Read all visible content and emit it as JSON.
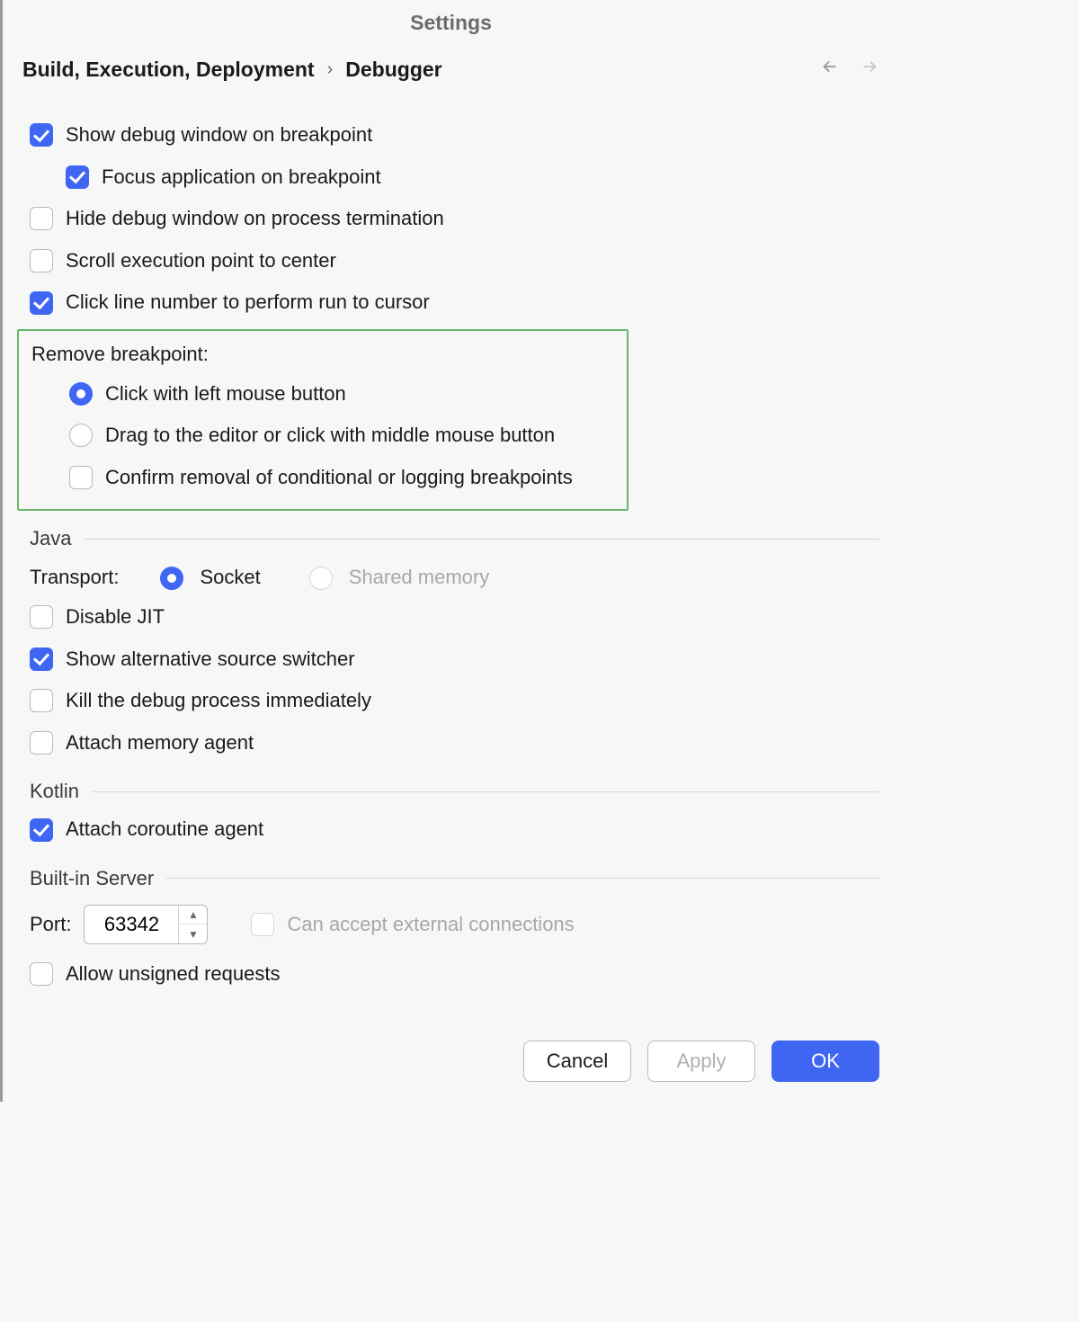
{
  "title": "Settings",
  "breadcrumb": {
    "parent": "Build, Execution, Deployment",
    "current": "Debugger"
  },
  "options": {
    "show_debug_window": "Show debug window on breakpoint",
    "focus_app": "Focus application on breakpoint",
    "hide_on_term": "Hide debug window on process termination",
    "scroll_center": "Scroll execution point to center",
    "click_line_run": "Click line number to perform run to cursor"
  },
  "remove_bp": {
    "title": "Remove breakpoint:",
    "opt_click": "Click with left mouse button",
    "opt_drag": "Drag to the editor or click with middle mouse button",
    "confirm": "Confirm removal of conditional or logging breakpoints"
  },
  "java": {
    "heading": "Java",
    "transport_label": "Transport:",
    "socket": "Socket",
    "shared_mem": "Shared memory",
    "disable_jit": "Disable JIT",
    "alt_source": "Show alternative source switcher",
    "kill_immediate": "Kill the debug process immediately",
    "attach_mem": "Attach memory agent"
  },
  "kotlin": {
    "heading": "Kotlin",
    "attach_coroutine": "Attach coroutine agent"
  },
  "server": {
    "heading": "Built-in Server",
    "port_label": "Port:",
    "port_value": "63342",
    "external": "Can accept external connections",
    "unsigned": "Allow unsigned requests"
  },
  "buttons": {
    "cancel": "Cancel",
    "apply": "Apply",
    "ok": "OK"
  }
}
